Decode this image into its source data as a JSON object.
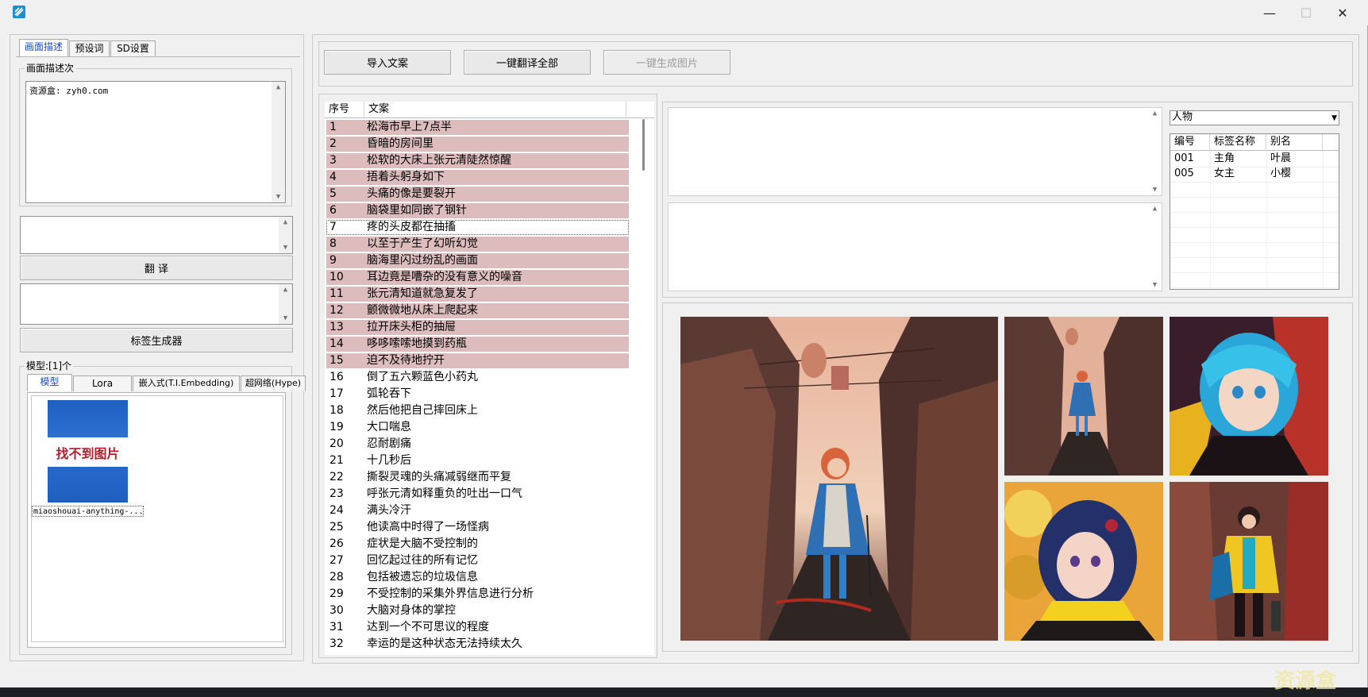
{
  "window": {
    "controls": {
      "minimize": "—",
      "maximize": "☐",
      "close": "✕"
    }
  },
  "left_panel": {
    "tabs": [
      "画面描述",
      "预设词",
      "SD设置"
    ],
    "description_group": {
      "title": "画面描述次",
      "text": "资源盒: zyh0.com"
    },
    "translate_button": "翻  译",
    "tag_generator_button": "标签生成器",
    "model_group": {
      "title": "模型:[1]个",
      "tabs": [
        "模型",
        "Lora",
        "嵌入式(T.I.Embedding)",
        "超网络(Hype)"
      ],
      "thumbnail_text": "找不到图片",
      "model_name": "miaoshouai-anything-..."
    }
  },
  "toolbar": {
    "import_button": "导入文案",
    "translate_all_button": "一键翻译全部",
    "generate_all_button": "一键生成图片"
  },
  "script_list": {
    "headers": [
      "序号",
      "文案"
    ],
    "rows": [
      [
        "1",
        "松海市早上7点半"
      ],
      [
        "2",
        "昏暗的房间里"
      ],
      [
        "3",
        "松软的大床上张元清陡然惊醒"
      ],
      [
        "4",
        "捂着头躬身如下"
      ],
      [
        "5",
        "头痛的像是要裂开"
      ],
      [
        "6",
        "脑袋里如同嵌了钢针"
      ],
      [
        "7",
        "疼的头皮都在抽搐"
      ],
      [
        "8",
        "以至于产生了幻听幻觉"
      ],
      [
        "9",
        "脑海里闪过纷乱的画面"
      ],
      [
        "10",
        "耳边竟是嘈杂的没有意义的噪音"
      ],
      [
        "11",
        "张元清知道就急复发了"
      ],
      [
        "12",
        "颤微微地从床上爬起来"
      ],
      [
        "13",
        "拉开床头柜的抽屉"
      ],
      [
        "14",
        "哆哆嗦嗦地摸到药瓶"
      ],
      [
        "15",
        "迫不及待地拧开"
      ],
      [
        "16",
        "倒了五六颗蓝色小药丸"
      ],
      [
        "17",
        "弧轮吞下"
      ],
      [
        "18",
        "然后他把自己摔回床上"
      ],
      [
        "19",
        "大口喘息"
      ],
      [
        "20",
        "忍耐剧痛"
      ],
      [
        "21",
        "十几秒后"
      ],
      [
        "22",
        "撕裂灵魂的头痛减弱继而平复"
      ],
      [
        "23",
        "呼张元清如释重负的吐出一口气"
      ],
      [
        "24",
        "满头冷汗"
      ],
      [
        "25",
        "他读高中时得了一场怪病"
      ],
      [
        "26",
        "症状是大脑不受控制的"
      ],
      [
        "27",
        "回忆起过往的所有记忆"
      ],
      [
        "28",
        "包括被遗忘的垃圾信息"
      ],
      [
        "29",
        "不受控制的采集外界信息进行分析"
      ],
      [
        "30",
        "大脑对身体的掌控"
      ],
      [
        "31",
        "达到一个不可思议的程度"
      ],
      [
        "32",
        "幸运的是这种状态无法持续太久"
      ]
    ],
    "selected_rows": 15,
    "focused_row": 7
  },
  "character_panel": {
    "dropdown_value": "人物",
    "headers": [
      "编号",
      "标签名称",
      "别名"
    ],
    "rows": [
      [
        "001",
        "主角",
        "叶晨"
      ],
      [
        "005",
        "女主",
        "小樱"
      ]
    ]
  },
  "colors": {
    "selection": "#dcbcbc",
    "window_bg": "#f0f0f0",
    "tab_active": "#1a4bd6",
    "placeholder_red": "#b01e2e",
    "placeholder_blue": "#1f5fbf"
  },
  "watermark": "资源盒"
}
